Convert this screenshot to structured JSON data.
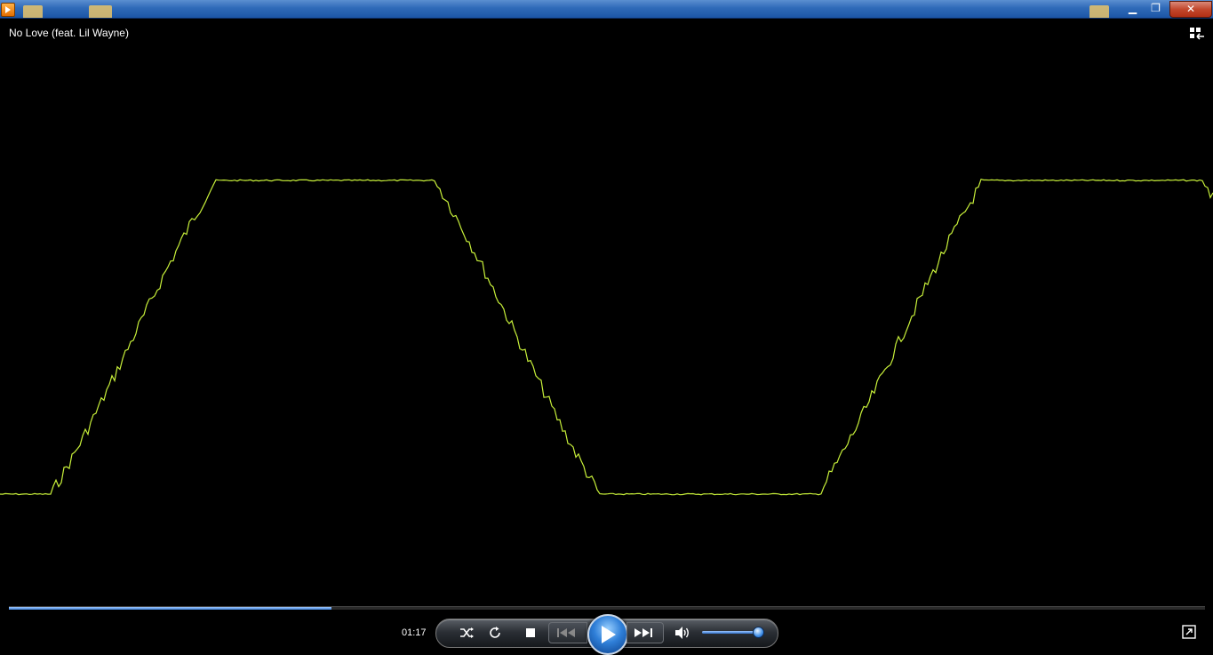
{
  "window": {
    "icons": [
      "media-player-app-icon",
      "folder-icon",
      "folder-icon",
      "folder-icon"
    ],
    "buttons": {
      "minimize": "▁",
      "maximize": "❐",
      "close": "✕"
    }
  },
  "now_playing": {
    "title": "No Love (feat. Lil Wayne)"
  },
  "visualization": {
    "color": "#c8f03a",
    "background": "#000000"
  },
  "playback": {
    "elapsed": "01:17",
    "seek_progress": 0.27,
    "volume_level": 0.88,
    "state": "paused"
  },
  "controls": {
    "icons": [
      "shuffle-icon",
      "repeat-icon",
      "stop-icon",
      "previous-icon",
      "play-icon",
      "next-icon",
      "volume-icon",
      "fullscreen-icon",
      "switch-to-library-icon"
    ]
  },
  "colors": {
    "accent": "#3d7fd6",
    "titlebar": "#2f6ab8"
  }
}
